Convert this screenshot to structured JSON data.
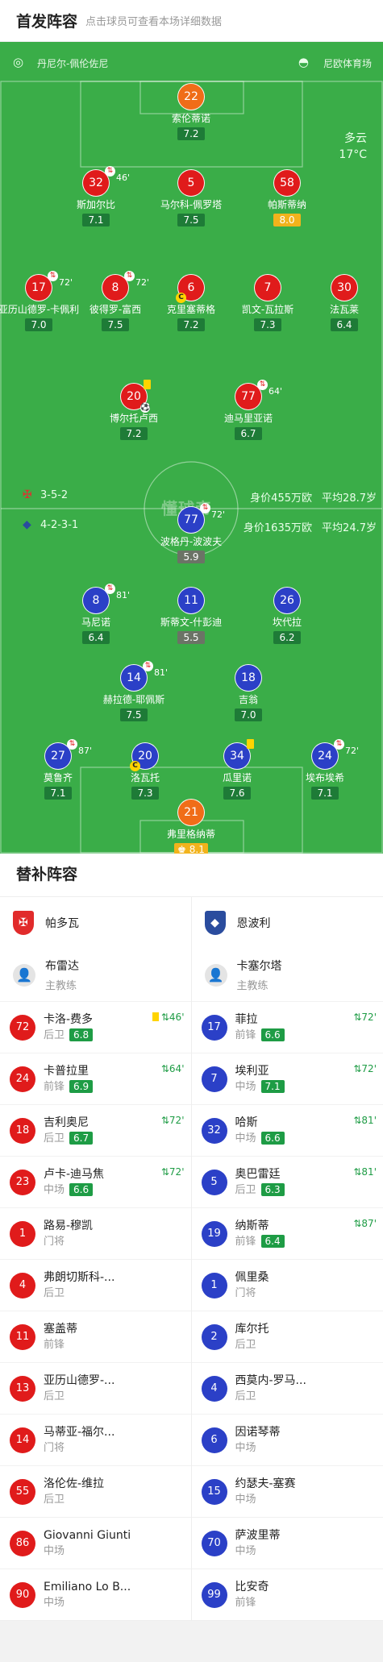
{
  "header": {
    "title": "首发阵容",
    "subtitle": "点击球员可查看本场详细数据"
  },
  "pitch": {
    "home_team": "丹尼尔-佩伦佐尼",
    "venue": "尼欧体育场",
    "weather": "多云",
    "temperature": "17°C",
    "watermark": "懂球帝",
    "home": {
      "formation": "3-5-2",
      "value": "身价455万欧",
      "avg_age": "平均28.7岁"
    },
    "away": {
      "formation": "4-2-3-1",
      "value": "身价1635万欧",
      "avg_age": "平均24.7岁"
    },
    "players": [
      {
        "num": "22",
        "name": "索伦蒂诺",
        "rating": "7.2",
        "color": "orange"
      },
      {
        "num": "32",
        "name": "斯加尔比",
        "rating": "7.1",
        "color": "red",
        "sub": "46'"
      },
      {
        "num": "5",
        "name": "马尔科-佩罗塔",
        "rating": "7.5",
        "color": "red"
      },
      {
        "num": "58",
        "name": "帕斯蒂纳",
        "rating": "8.0",
        "color": "red",
        "best": true
      },
      {
        "num": "17",
        "name": "亚历山德罗-卡佩利",
        "rating": "7.0",
        "color": "red",
        "sub": "72'"
      },
      {
        "num": "8",
        "name": "彼得罗-富西",
        "rating": "7.5",
        "color": "red",
        "sub": "72'"
      },
      {
        "num": "6",
        "name": "克里塞蒂格",
        "rating": "7.2",
        "color": "red",
        "captain": true
      },
      {
        "num": "7",
        "name": "凯文-瓦拉斯",
        "rating": "7.3",
        "color": "red"
      },
      {
        "num": "30",
        "name": "法瓦莱",
        "rating": "6.4",
        "color": "red"
      },
      {
        "num": "20",
        "name": "博尔托卢西",
        "rating": "7.2",
        "color": "red",
        "yellow": true,
        "goal": true
      },
      {
        "num": "77",
        "name": "迪马里亚诺",
        "rating": "6.7",
        "color": "red",
        "sub": "64'"
      },
      {
        "num": "77",
        "name": "波格丹-波波夫",
        "rating": "5.9",
        "color": "blue",
        "sub": "72'",
        "low": true
      },
      {
        "num": "8",
        "name": "马尼诺",
        "rating": "6.4",
        "color": "blue",
        "sub": "81'"
      },
      {
        "num": "11",
        "name": "斯蒂文-什彭迪",
        "rating": "5.5",
        "color": "blue",
        "low": true
      },
      {
        "num": "26",
        "name": "坎代拉",
        "rating": "6.2",
        "color": "blue"
      },
      {
        "num": "14",
        "name": "赫拉德-耶佩斯",
        "rating": "7.5",
        "color": "blue",
        "sub": "81'"
      },
      {
        "num": "18",
        "name": "吉翁",
        "rating": "7.0",
        "color": "blue"
      },
      {
        "num": "27",
        "name": "莫鲁齐",
        "rating": "7.1",
        "color": "blue",
        "sub": "87'"
      },
      {
        "num": "20",
        "name": "洛瓦托",
        "rating": "7.3",
        "color": "blue",
        "captain": true
      },
      {
        "num": "34",
        "name": "瓜里诺",
        "rating": "7.6",
        "color": "blue",
        "yellow": true
      },
      {
        "num": "24",
        "name": "埃布埃希",
        "rating": "7.1",
        "color": "blue",
        "sub": "72'"
      },
      {
        "num": "21",
        "name": "弗里格纳蒂",
        "rating": "8.1",
        "color": "orange",
        "best": true,
        "star": true
      }
    ]
  },
  "subs": {
    "title": "替补阵容",
    "home": {
      "team": "帕多瓦",
      "coach_name": "布雷达",
      "coach_role": "主教练",
      "players": [
        {
          "num": "72",
          "name": "卡洛-费多",
          "pos": "后卫",
          "rating": "6.8",
          "event": "46'",
          "yellow": true
        },
        {
          "num": "24",
          "name": "卡普拉里",
          "pos": "前锋",
          "rating": "6.9",
          "event": "64'"
        },
        {
          "num": "18",
          "name": "吉利奥尼",
          "pos": "后卫",
          "rating": "6.7",
          "event": "72'"
        },
        {
          "num": "23",
          "name": "卢卡-迪马焦",
          "pos": "中场",
          "rating": "6.6",
          "event": "72'"
        },
        {
          "num": "1",
          "name": "路易-穆凯",
          "pos": "门将"
        },
        {
          "num": "4",
          "name": "弗朗切斯科-...",
          "pos": "后卫"
        },
        {
          "num": "11",
          "name": "塞盖蒂",
          "pos": "前锋"
        },
        {
          "num": "13",
          "name": "亚历山德罗-...",
          "pos": "后卫"
        },
        {
          "num": "14",
          "name": "马蒂亚-福尔...",
          "pos": "门将"
        },
        {
          "num": "55",
          "name": "洛伦佐-维拉",
          "pos": "后卫"
        },
        {
          "num": "86",
          "name": "Giovanni Giunti",
          "pos": "中场"
        },
        {
          "num": "90",
          "name": "Emiliano Lo B...",
          "pos": "中场"
        }
      ]
    },
    "away": {
      "team": "恩波利",
      "coach_name": "卡塞尔塔",
      "coach_role": "主教练",
      "players": [
        {
          "num": "17",
          "name": "菲拉",
          "pos": "前锋",
          "rating": "6.6",
          "event": "72'"
        },
        {
          "num": "7",
          "name": "埃利亚",
          "pos": "中场",
          "rating": "7.1",
          "event": "72'"
        },
        {
          "num": "32",
          "name": "哈斯",
          "pos": "中场",
          "rating": "6.6",
          "event": "81'"
        },
        {
          "num": "5",
          "name": "奥巴雷廷",
          "pos": "后卫",
          "rating": "6.3",
          "event": "81'"
        },
        {
          "num": "19",
          "name": "纳斯蒂",
          "pos": "前锋",
          "rating": "6.4",
          "event": "87'"
        },
        {
          "num": "1",
          "name": "佩里桑",
          "pos": "门将"
        },
        {
          "num": "2",
          "name": "库尔托",
          "pos": "后卫"
        },
        {
          "num": "4",
          "name": "西莫内-罗马...",
          "pos": "后卫"
        },
        {
          "num": "6",
          "name": "因诺琴蒂",
          "pos": "中场"
        },
        {
          "num": "15",
          "name": "约瑟夫-塞赛",
          "pos": "中场"
        },
        {
          "num": "70",
          "name": "萨波里蒂",
          "pos": "中场"
        },
        {
          "num": "99",
          "name": "比安奇",
          "pos": "前锋"
        }
      ]
    }
  }
}
